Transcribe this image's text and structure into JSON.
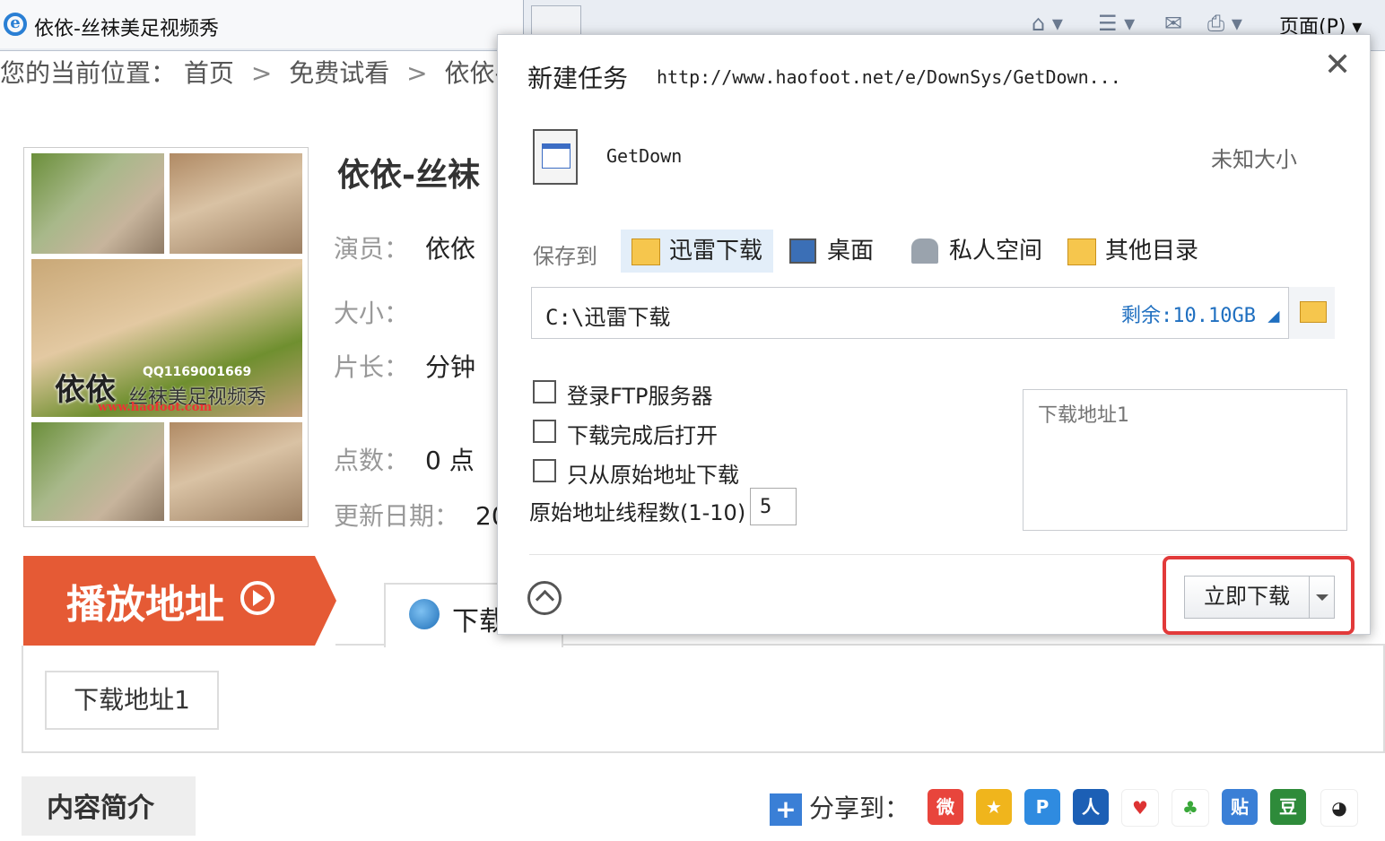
{
  "browser": {
    "tab_title": "依依-丝袜美足视频秀",
    "page_menu": "页面(P) ▾"
  },
  "breadcrumb": {
    "prefix": "您的当前位置：",
    "items": [
      "首页",
      "免费试看",
      "依依-丝"
    ]
  },
  "thumbnail": {
    "name": "依依",
    "qq": "QQ1169001669",
    "subtitle": "丝袜美足视频秀",
    "url": "www.haofoot.com"
  },
  "info": {
    "title": "依依-丝袜",
    "actor_label": "演员：",
    "actor": "依依",
    "size_label": "大小：",
    "length_label": "片长：",
    "length": "分钟",
    "points_label": "点数：",
    "points": "0 点",
    "date_label": "更新日期：",
    "date": "20"
  },
  "play": {
    "title": "播放地址",
    "tab_label": "下载",
    "download_link": "下载地址1"
  },
  "intro": {
    "title": "内容简介"
  },
  "share": {
    "label": "分享到：",
    "icons": [
      "weibo-icon",
      "qzone-icon",
      "pengyou-icon",
      "renren-icon",
      "kaixin-icon",
      "clover-icon",
      "tieba-icon",
      "douban-icon",
      "qq-icon"
    ]
  },
  "dialog": {
    "title": "新建任务",
    "url": "http://www.haofoot.net/e/DownSys/GetDown...",
    "close": "✕",
    "file_name": "GetDown",
    "file_size": "未知大小",
    "save_to_label": "保存到",
    "save_options": [
      "迅雷下载",
      "桌面",
      "私人空间",
      "其他目录"
    ],
    "path": "C:\\迅雷下载",
    "free_space": "剩余:10.10GB ◢",
    "options": {
      "ftp": "登录FTP服务器",
      "open_after": "下载完成后打开",
      "original_only": "只从原始地址下载"
    },
    "threads_label": "原始地址线程数(1-10)",
    "threads_value": "5",
    "address_placeholder": "下载地址1",
    "download_now": "立即下载"
  },
  "colors": {
    "accent_red": "#e55a35",
    "highlight_red": "#e23a3a",
    "link_blue": "#1f6fc0"
  }
}
